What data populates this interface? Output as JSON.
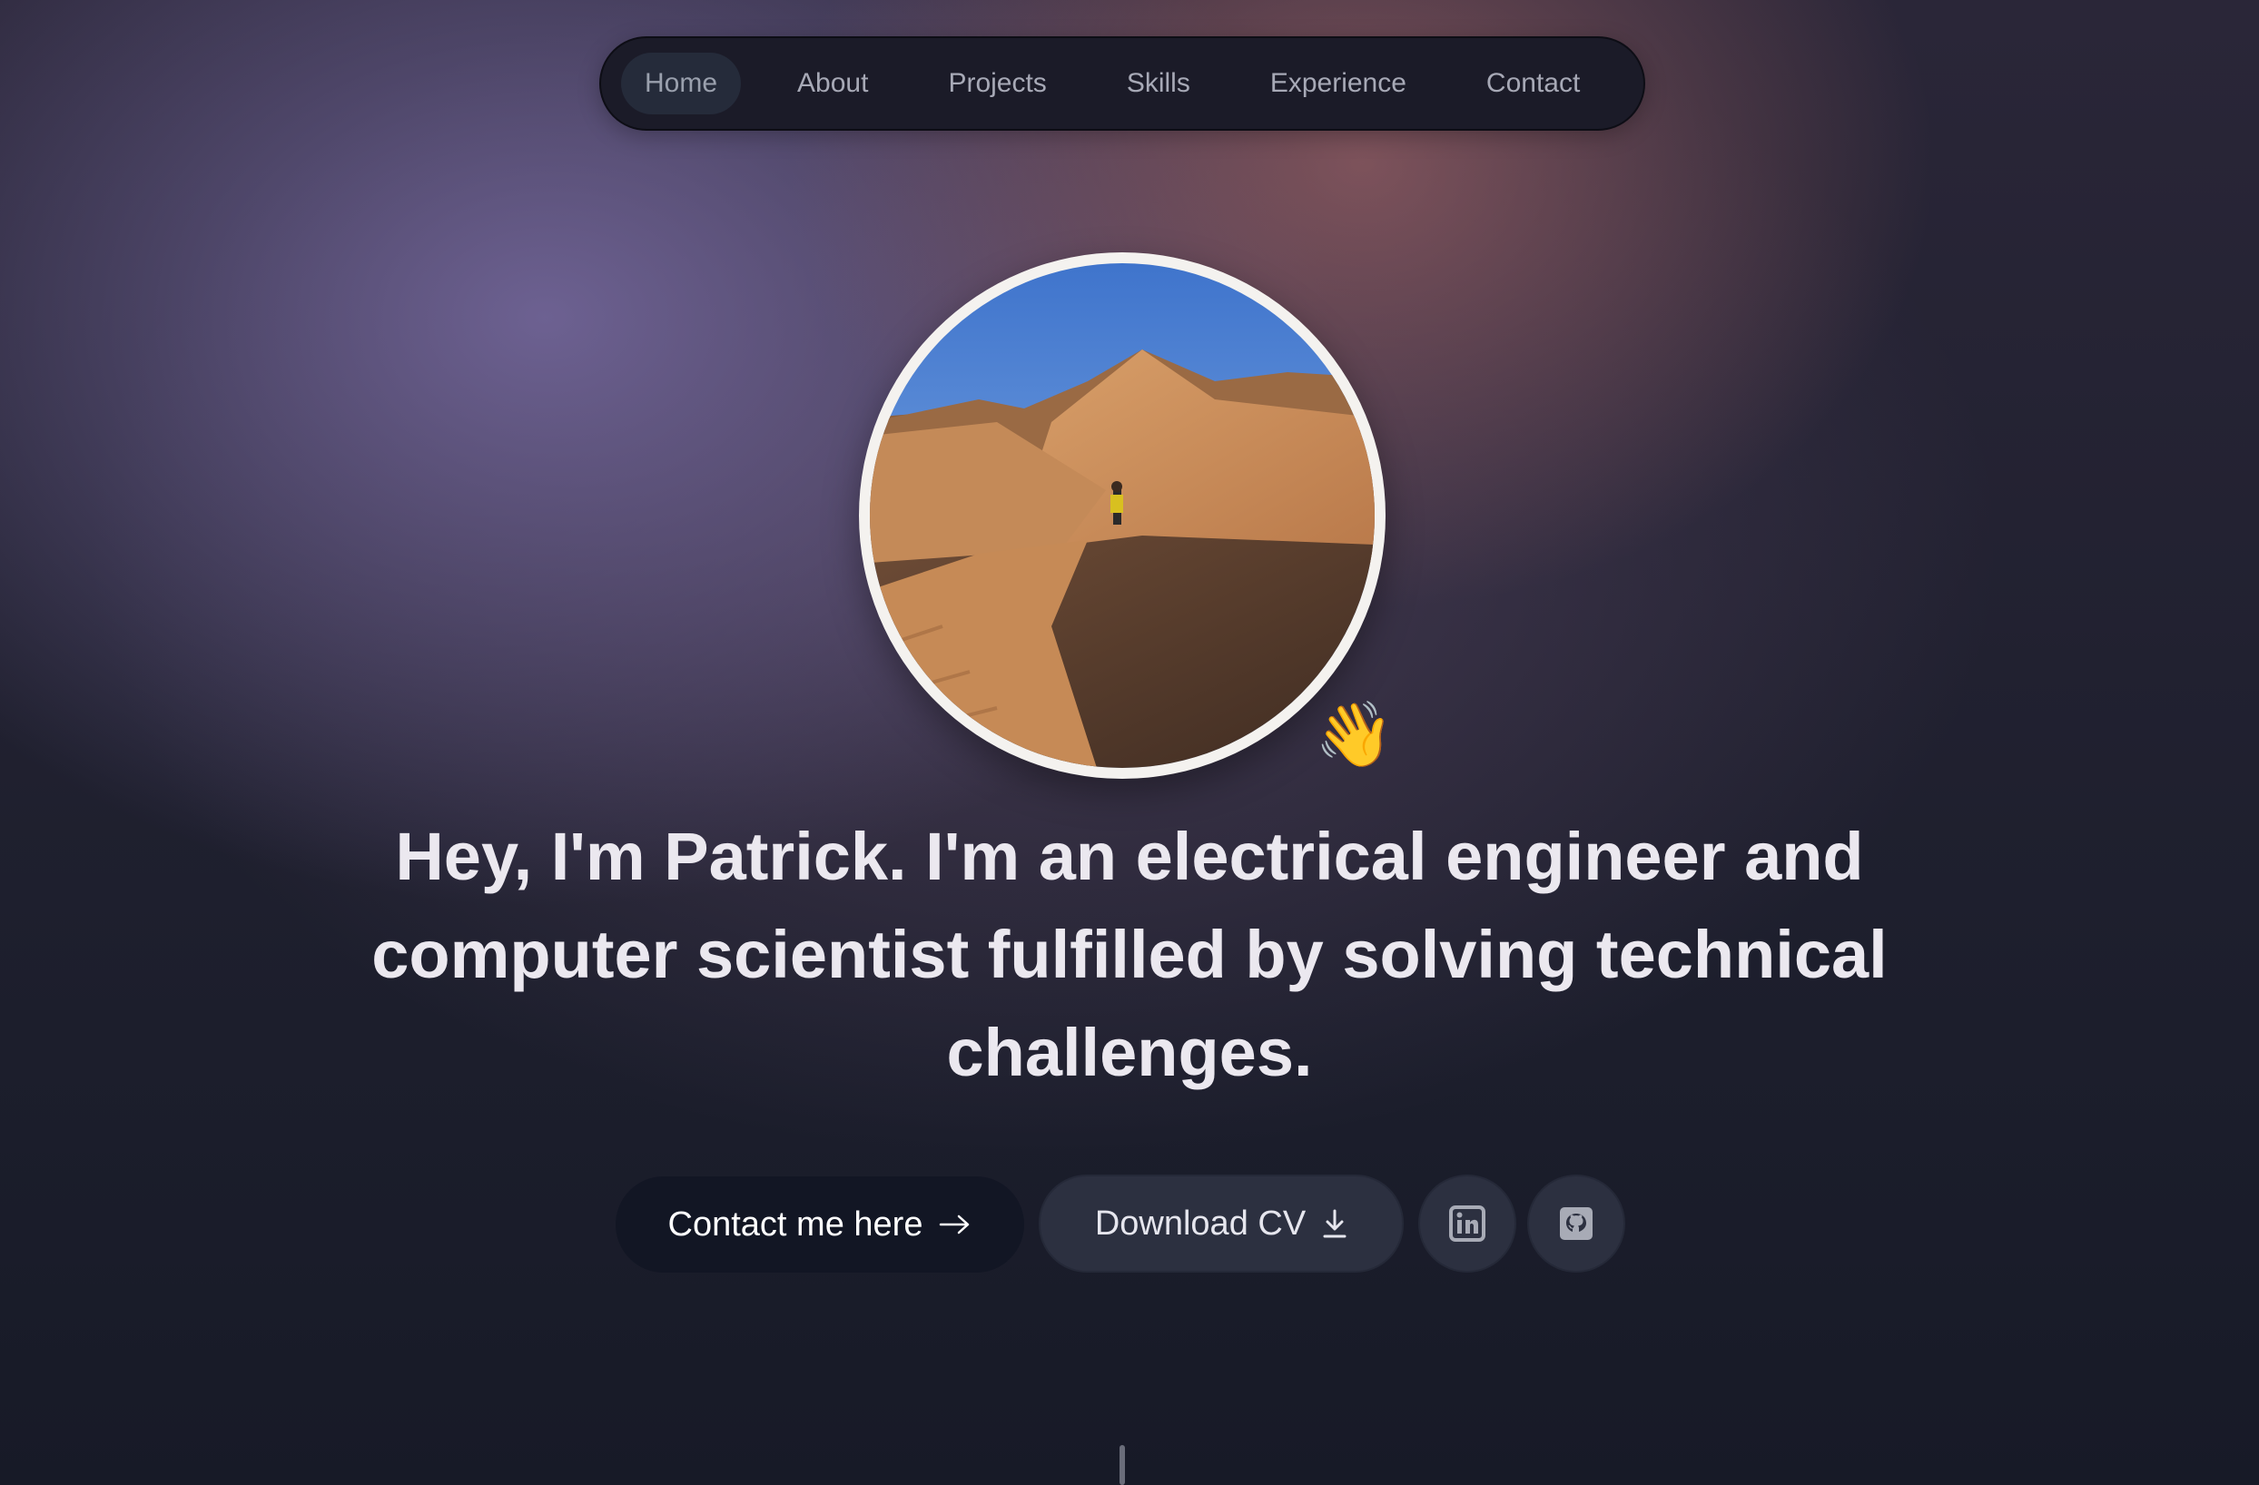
{
  "nav": {
    "items": [
      {
        "label": "Home",
        "active": true
      },
      {
        "label": "About"
      },
      {
        "label": "Projects"
      },
      {
        "label": "Skills"
      },
      {
        "label": "Experience"
      },
      {
        "label": "Contact"
      }
    ]
  },
  "hero": {
    "avatar_icon": "profile-photo-desert-dunes",
    "wave_emoji": "👋",
    "headline": {
      "part1": "Hey, I'm Patrick.",
      "part2": " I'm an ",
      "part3": "electrical engineer",
      "part4": " and ",
      "part5": "computer scientist",
      "part6": " fulfilled by solving technical challenges."
    }
  },
  "actions": {
    "contact_label": "Contact me here",
    "contact_icon": "arrow-right-icon",
    "cv_label": "Download CV",
    "cv_icon": "download-icon",
    "linkedin_icon": "linkedin-icon",
    "github_icon": "github-icon"
  },
  "colors": {
    "nav_bg": "#1b1b28",
    "primary_button": "#121624",
    "secondary_button": "#2c3040"
  }
}
